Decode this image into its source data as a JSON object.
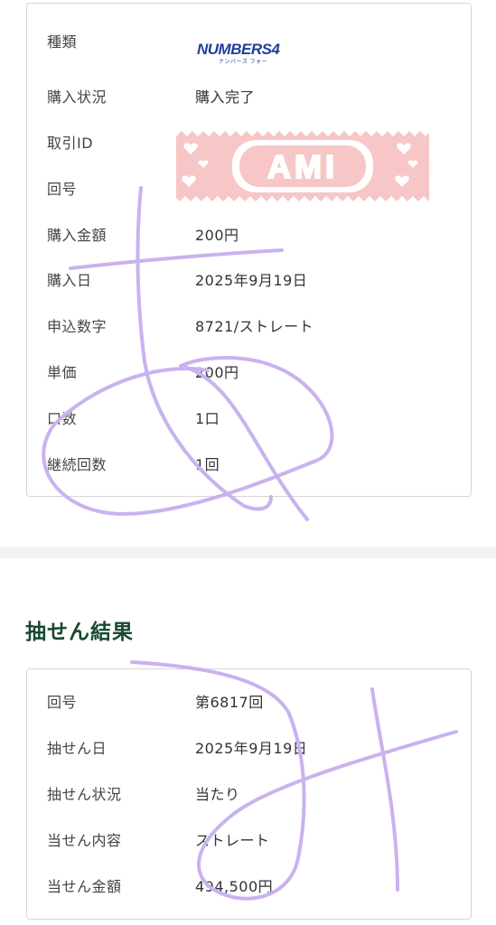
{
  "purchase": {
    "rows": [
      {
        "label": "種類",
        "value": ""
      },
      {
        "label": "購入状況",
        "value": "購入完了"
      },
      {
        "label": "取引ID",
        "value": ""
      },
      {
        "label": "回号",
        "value": ""
      },
      {
        "label": "購入金額",
        "value": "200円"
      },
      {
        "label": "購入日",
        "value": "2025年9月19日"
      },
      {
        "label": "申込数字",
        "value": "8721/ストレート"
      },
      {
        "label": "単価",
        "value": "200円"
      },
      {
        "label": "口数",
        "value": "1口"
      },
      {
        "label": "継続回数",
        "value": "1回"
      }
    ],
    "logo": {
      "main": "NUMBERS4",
      "sub": "ナンバーズ フォー"
    },
    "sticker_text": "AMI"
  },
  "result": {
    "title": "抽せん結果",
    "rows": [
      {
        "label": "回号",
        "value": "第6817回"
      },
      {
        "label": "抽せん日",
        "value": "2025年9月19日"
      },
      {
        "label": "抽せん状況",
        "value": "当たり"
      },
      {
        "label": "当せん内容",
        "value": "ストレート"
      },
      {
        "label": "当せん金額",
        "value": "494,500円"
      }
    ]
  },
  "colors": {
    "title_green": "#164a2e",
    "sticker_pink": "#f7c6c6",
    "scribble_purple": "#c9b2ee",
    "logo_blue": "#1f3f9a",
    "logo_green": "#2f9a3a",
    "logo_yellow": "#f3c316"
  }
}
